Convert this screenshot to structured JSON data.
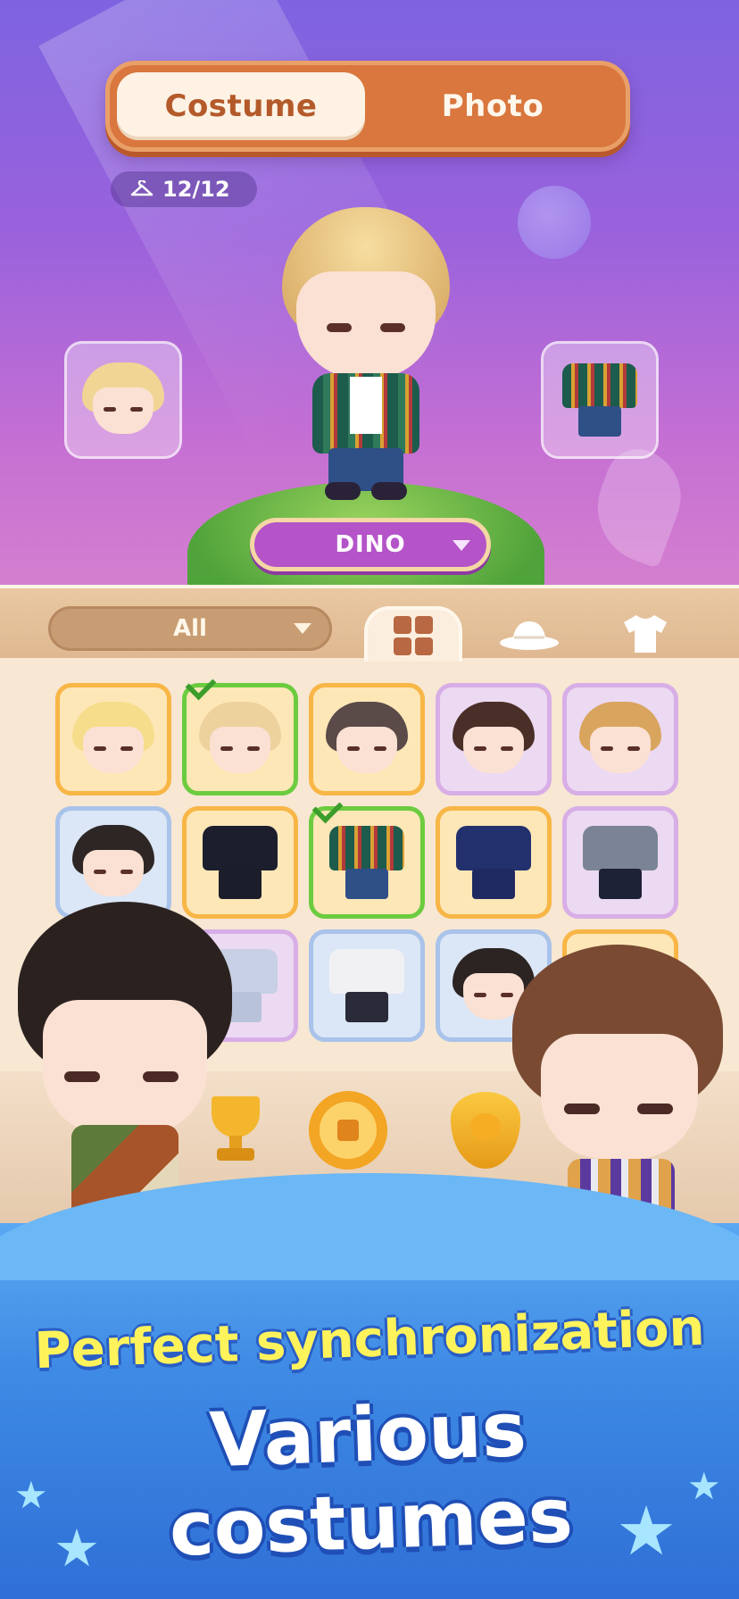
{
  "top_tabs": {
    "costume": "Costume",
    "photo": "Photo"
  },
  "counter": {
    "icon": "hanger-icon",
    "text": "12/12"
  },
  "character": {
    "name": "DINO"
  },
  "filter": {
    "dropdown_value": "All"
  },
  "category_tabs": [
    {
      "name": "grid-icon",
      "active": true
    },
    {
      "name": "hat-icon",
      "active": false
    },
    {
      "name": "tshirt-icon",
      "active": false
    }
  ],
  "bottom_nav": [
    {
      "name": "trophy-icon"
    },
    {
      "name": "ship-wheel-home-icon"
    },
    {
      "name": "guild-shield-icon"
    }
  ],
  "banner": {
    "line1": "Perfect synchronization",
    "line2": "Various costumes"
  },
  "colors": {
    "accent_orange": "#d9773e",
    "selected_green": "#6ccc3f",
    "banner_blue": "#3e8ae4",
    "banner_yellow": "#fff35c"
  }
}
